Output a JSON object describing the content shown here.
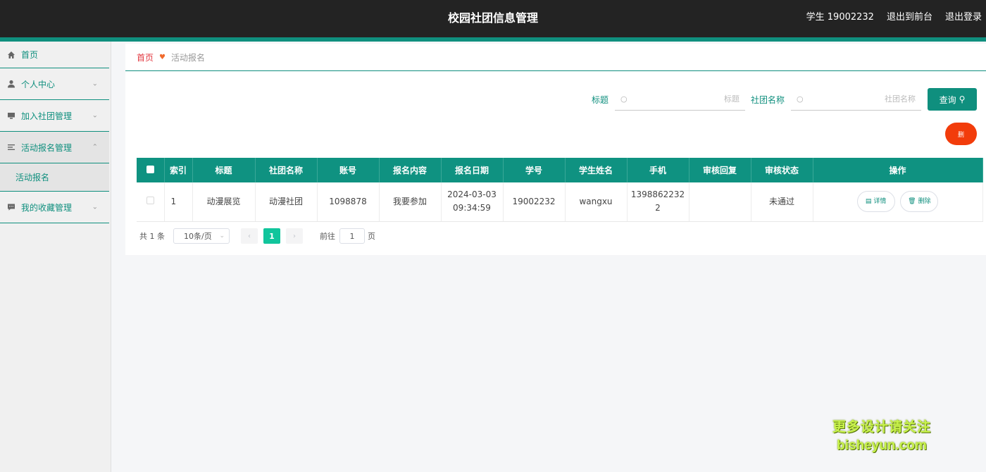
{
  "header": {
    "title": "校园社团信息管理",
    "user": "学生 19002232",
    "goto_front": "退出到前台",
    "logout": "退出登录"
  },
  "sidebar": {
    "items": [
      {
        "label": "首页"
      },
      {
        "label": "个人中心"
      },
      {
        "label": "加入社团管理"
      },
      {
        "label": "活动报名管理"
      },
      {
        "label": "我的收藏管理"
      }
    ],
    "submenu": "活动报名"
  },
  "breadcrumb": {
    "home": "首页",
    "current": "活动报名"
  },
  "search": {
    "title_label": "标题",
    "title_placeholder": "标题",
    "club_label": "社团名称",
    "club_placeholder": "社团名称",
    "query_label": "查询"
  },
  "delete_button": "删",
  "table": {
    "columns": [
      "索引",
      "标题",
      "社团名称",
      "账号",
      "报名内容",
      "报名日期",
      "学号",
      "学生姓名",
      "手机",
      "审核回复",
      "审核状态",
      "操作"
    ],
    "rows": [
      {
        "index": "1",
        "title": "动漫展览",
        "club": "动漫社团",
        "account": "1098878",
        "content": "我要参加",
        "date_line1": "2024-03-03",
        "date_line2": "09:34:59",
        "student_no": "19002232",
        "student_name": "wangxu",
        "phone_line1": "1398862232",
        "phone_line2": "2",
        "reply": "",
        "status": "未通过",
        "detail_label": "详情",
        "delete_label": "删除"
      }
    ]
  },
  "pagination": {
    "total": "共 1 条",
    "page_size": "10条/页",
    "current_page": "1",
    "goto_label": "前往",
    "goto_value": "1",
    "page_suffix": "页"
  },
  "watermark": {
    "line1": "更多设计请关注",
    "line2": "bisheyun.com"
  },
  "colors": {
    "accent": "#0f8f7e",
    "danger": "#f23c0b",
    "page_active": "#11c59c"
  }
}
